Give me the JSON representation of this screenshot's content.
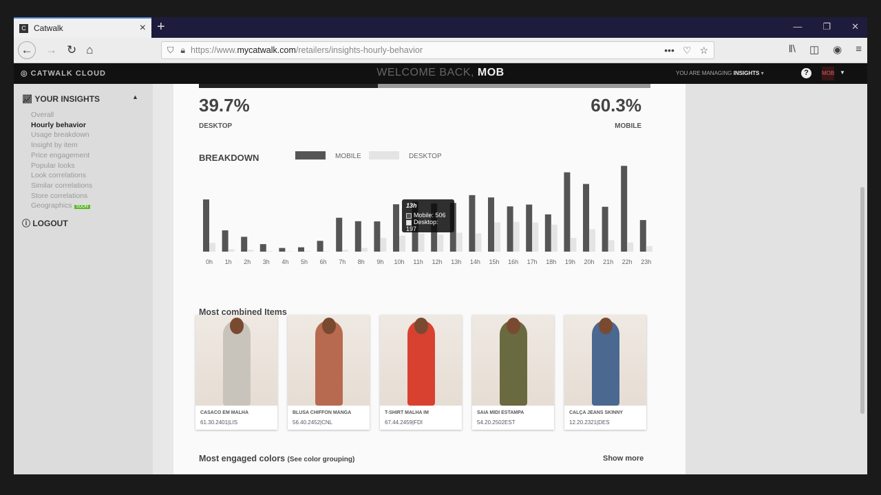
{
  "browser": {
    "tab_title": "Catwalk",
    "url_prefix": "https://www.",
    "url_domain": "mycatwalk.com",
    "url_path": "/retailers/insights-hourly-behavior"
  },
  "header": {
    "logo": "CATWALK CLOUD",
    "welcome": "WELCOME BACK,",
    "user": "MOB",
    "managing_label": "YOU ARE MANAGING",
    "managing_value": "INSIGHTS",
    "help": "?",
    "avatar": "MOB"
  },
  "sidebar": {
    "title": "YOUR INSIGHTS",
    "items": [
      {
        "label": "Overall"
      },
      {
        "label": "Hourly behavior",
        "active": true
      },
      {
        "label": "Usage breakdown"
      },
      {
        "label": "Insight by item"
      },
      {
        "label": "Price engagement"
      },
      {
        "label": "Popular looks"
      },
      {
        "label": "Look correlations"
      },
      {
        "label": "Similar correlations"
      },
      {
        "label": "Store correlations"
      },
      {
        "label": "Geographics"
      }
    ],
    "soon_badge": "SOON",
    "logout": "LOGOUT"
  },
  "split": {
    "desktop_pct": "39.7%",
    "desktop_label": "DESKTOP",
    "mobile_pct": "60.3%",
    "mobile_label": "MOBILE",
    "desktop_fraction": 0.397
  },
  "chart_data": {
    "type": "bar",
    "title": "BREAKDOWN",
    "categories": [
      "0h",
      "1h",
      "2h",
      "3h",
      "4h",
      "5h",
      "6h",
      "7h",
      "8h",
      "9h",
      "10h",
      "11h",
      "12h",
      "13h",
      "14h",
      "15h",
      "16h",
      "17h",
      "18h",
      "19h",
      "20h",
      "21h",
      "22h",
      "23h"
    ],
    "series": [
      {
        "name": "MOBILE",
        "color": "#555555",
        "values": [
          542,
          221,
          154,
          78,
          38,
          45,
          112,
          352,
          316,
          314,
          492,
          520,
          500,
          506,
          587,
          563,
          470,
          489,
          387,
          824,
          703,
          466,
          891,
          328
        ]
      },
      {
        "name": "DESKTOP",
        "color": "#e4e4e4",
        "values": [
          90,
          24,
          19,
          7,
          5,
          5,
          5,
          19,
          38,
          143,
          166,
          190,
          178,
          197,
          190,
          304,
          309,
          302,
          280,
          143,
          233,
          119,
          95,
          57
        ]
      }
    ],
    "ylim": [
      0,
      900
    ],
    "legend": "top",
    "tooltip": {
      "title": "13h",
      "mobile": "Mobile: 506",
      "desktop": "Desktop: 197"
    }
  },
  "combined": {
    "title": "Most combined Items",
    "items": [
      {
        "name": "CASACO EM MALHA",
        "code": "61.30.2401|LIS",
        "color": "#c8c4bc"
      },
      {
        "name": "BLUSA CHIFFON MANGA",
        "code": "56.40.2452|CNL",
        "color": "#b86a50"
      },
      {
        "name": "T-SHIRT MALHA IM",
        "code": "67.44.2459|FDI",
        "color": "#d84030"
      },
      {
        "name": "SAIA MIDI ESTAMPA",
        "code": "54.20.2502EST",
        "color": "#6a6a40"
      },
      {
        "name": "CALÇA JEANS SKINNY",
        "code": "12.20.2321|DES",
        "color": "#4a6890"
      }
    ]
  },
  "colors_section": {
    "title": "Most engaged colors",
    "link": "(See color grouping)",
    "show_more": "Show more"
  }
}
